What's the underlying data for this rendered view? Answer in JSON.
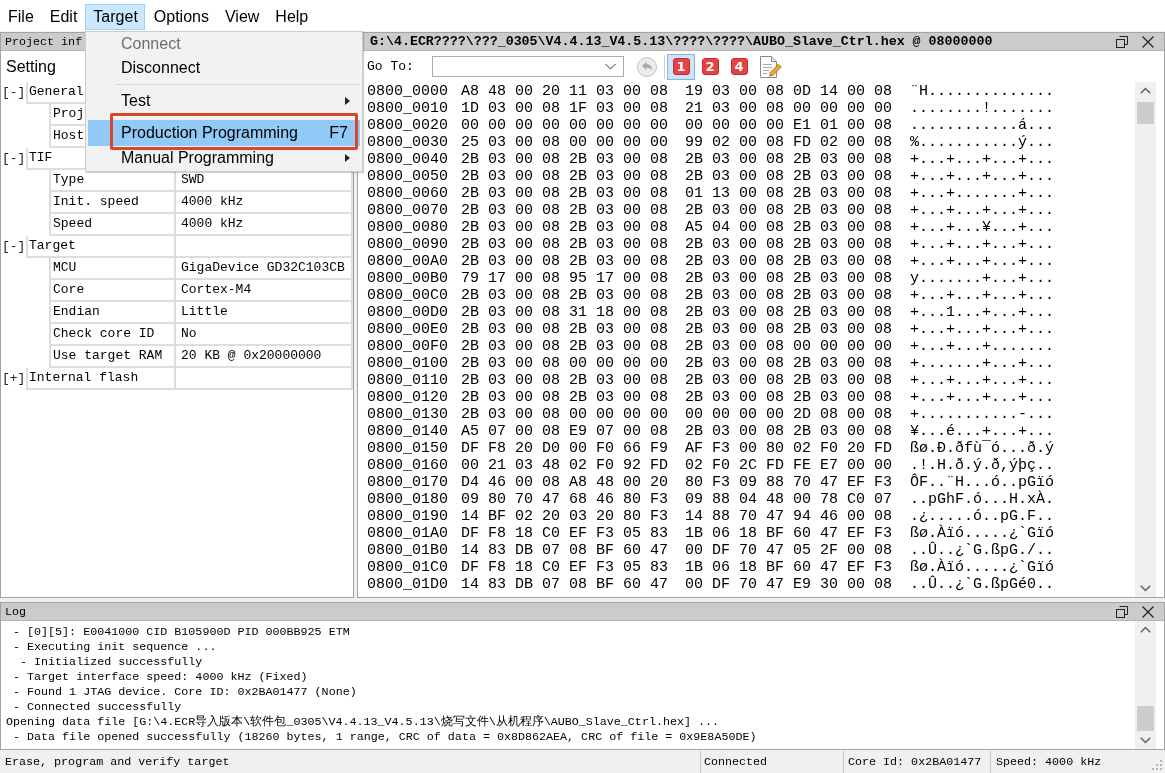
{
  "menu_bar": {
    "items": [
      {
        "label": "File",
        "selected": false
      },
      {
        "label": "Edit",
        "selected": false
      },
      {
        "label": "Target",
        "selected": true
      },
      {
        "label": "Options",
        "selected": false
      },
      {
        "label": "View",
        "selected": false
      },
      {
        "label": "Help",
        "selected": false
      }
    ]
  },
  "dropdown_menu": {
    "items": [
      {
        "kind": "item",
        "label": "Connect",
        "disabled": true,
        "selected": false,
        "marked": false
      },
      {
        "kind": "item",
        "label": "Disconnect",
        "disabled": false,
        "selected": false,
        "marked": false
      },
      {
        "kind": "separator"
      },
      {
        "kind": "submenu",
        "label": "Test",
        "disabled": false,
        "selected": false,
        "marked": false
      },
      {
        "kind": "item",
        "label": "Production Programming",
        "shortcut": "F7",
        "disabled": false,
        "selected": true,
        "marked": true
      },
      {
        "kind": "submenu",
        "label": "Manual Programming",
        "disabled": false,
        "selected": false,
        "marked": false
      }
    ]
  },
  "project_panel": {
    "title": "Project inf",
    "header": "Setting",
    "tree": [
      {
        "toggle": "[-]",
        "label": "General",
        "children": [
          {
            "label": "Proj"
          },
          {
            "label": "Host"
          }
        ]
      },
      {
        "toggle": "[-]",
        "label": "TIF",
        "children": [
          {
            "label": "Type",
            "value": "SWD"
          },
          {
            "label": "Init. speed",
            "value": "4000 kHz"
          },
          {
            "label": "Speed",
            "value": "4000 kHz"
          }
        ]
      },
      {
        "toggle": "[-]",
        "label": "Target",
        "children": [
          {
            "label": "MCU",
            "value": "GigaDevice GD32C103CB"
          },
          {
            "label": "Core",
            "value": "Cortex-M4"
          },
          {
            "label": "Endian",
            "value": "Little"
          },
          {
            "label": "Check core ID",
            "value": "No"
          },
          {
            "label": "Use target RAM",
            "value": "20 KB @ 0x20000000"
          }
        ]
      },
      {
        "toggle": "[+]",
        "label": "Internal flash"
      }
    ]
  },
  "hex_view": {
    "title": "G:\\4.ECR????\\???_0305\\V4.4.13_V4.5.13\\????\\????\\AUBO_Slave_Ctrl.hex @ 08000000",
    "goto_label": "Go To:",
    "toolbar": [
      {
        "kind": "back",
        "disabled": true
      },
      {
        "kind": "view",
        "label": "1",
        "selected": true
      },
      {
        "kind": "view",
        "label": "2",
        "selected": false
      },
      {
        "kind": "view",
        "label": "4",
        "selected": false
      },
      {
        "kind": "notes"
      }
    ],
    "rows": [
      {
        "address": "0800_0000",
        "bytes_1": "A8 48 00 20 11 03 00 08",
        "bytes_2": "19 03 00 08 0D 14 00 08",
        "ascii": "¨H.............."
      },
      {
        "address": "0800_0010",
        "bytes_1": "1D 03 00 08 1F 03 00 08",
        "bytes_2": "21 03 00 08 00 00 00 00",
        "ascii": "........!......."
      },
      {
        "address": "0800_0020",
        "bytes_1": "00 00 00 00 00 00 00 00",
        "bytes_2": "00 00 00 00 E1 01 00 08",
        "ascii": "............á..."
      },
      {
        "address": "0800_0030",
        "bytes_1": "25 03 00 08 00 00 00 00",
        "bytes_2": "99 02 00 08 FD 02 00 08",
        "ascii": "%...........ý..."
      },
      {
        "address": "0800_0040",
        "bytes_1": "2B 03 00 08 2B 03 00 08",
        "bytes_2": "2B 03 00 08 2B 03 00 08",
        "ascii": "+...+...+...+..."
      },
      {
        "address": "0800_0050",
        "bytes_1": "2B 03 00 08 2B 03 00 08",
        "bytes_2": "2B 03 00 08 2B 03 00 08",
        "ascii": "+...+...+...+..."
      },
      {
        "address": "0800_0060",
        "bytes_1": "2B 03 00 08 2B 03 00 08",
        "bytes_2": "01 13 00 08 2B 03 00 08",
        "ascii": "+...+.......+..."
      },
      {
        "address": "0800_0070",
        "bytes_1": "2B 03 00 08 2B 03 00 08",
        "bytes_2": "2B 03 00 08 2B 03 00 08",
        "ascii": "+...+...+...+..."
      },
      {
        "address": "0800_0080",
        "bytes_1": "2B 03 00 08 2B 03 00 08",
        "bytes_2": "A5 04 00 08 2B 03 00 08",
        "ascii": "+...+...¥...+..."
      },
      {
        "address": "0800_0090",
        "bytes_1": "2B 03 00 08 2B 03 00 08",
        "bytes_2": "2B 03 00 08 2B 03 00 08",
        "ascii": "+...+...+...+..."
      },
      {
        "address": "0800_00A0",
        "bytes_1": "2B 03 00 08 2B 03 00 08",
        "bytes_2": "2B 03 00 08 2B 03 00 08",
        "ascii": "+...+...+...+..."
      },
      {
        "address": "0800_00B0",
        "bytes_1": "79 17 00 08 95 17 00 08",
        "bytes_2": "2B 03 00 08 2B 03 00 08",
        "ascii": "y.......+...+..."
      },
      {
        "address": "0800_00C0",
        "bytes_1": "2B 03 00 08 2B 03 00 08",
        "bytes_2": "2B 03 00 08 2B 03 00 08",
        "ascii": "+...+...+...+..."
      },
      {
        "address": "0800_00D0",
        "bytes_1": "2B 03 00 08 31 18 00 08",
        "bytes_2": "2B 03 00 08 2B 03 00 08",
        "ascii": "+...1...+...+..."
      },
      {
        "address": "0800_00E0",
        "bytes_1": "2B 03 00 08 2B 03 00 08",
        "bytes_2": "2B 03 00 08 2B 03 00 08",
        "ascii": "+...+...+...+..."
      },
      {
        "address": "0800_00F0",
        "bytes_1": "2B 03 00 08 2B 03 00 08",
        "bytes_2": "2B 03 00 08 00 00 00 00",
        "ascii": "+...+...+......."
      },
      {
        "address": "0800_0100",
        "bytes_1": "2B 03 00 08 00 00 00 00",
        "bytes_2": "2B 03 00 08 2B 03 00 08",
        "ascii": "+.......+...+..."
      },
      {
        "address": "0800_0110",
        "bytes_1": "2B 03 00 08 2B 03 00 08",
        "bytes_2": "2B 03 00 08 2B 03 00 08",
        "ascii": "+...+...+...+..."
      },
      {
        "address": "0800_0120",
        "bytes_1": "2B 03 00 08 2B 03 00 08",
        "bytes_2": "2B 03 00 08 2B 03 00 08",
        "ascii": "+...+...+...+..."
      },
      {
        "address": "0800_0130",
        "bytes_1": "2B 03 00 08 00 00 00 00",
        "bytes_2": "00 00 00 00 2D 08 00 08",
        "ascii": "+...........-..."
      },
      {
        "address": "0800_0140",
        "bytes_1": "A5 07 00 08 E9 07 00 08",
        "bytes_2": "2B 03 00 08 2B 03 00 08",
        "ascii": "¥...é...+...+..."
      },
      {
        "address": "0800_0150",
        "bytes_1": "DF F8 20 D0 00 F0 66 F9",
        "bytes_2": "AF F3 00 80 02 F0 20 FD",
        "ascii": "ßø.Ð.ðfù¯ó...ð.ý"
      },
      {
        "address": "0800_0160",
        "bytes_1": "00 21 03 48 02 F0 92 FD",
        "bytes_2": "02 F0 2C FD FE E7 00 00",
        "ascii": ".!.H.ð.ý.ð,ýþç.."
      },
      {
        "address": "0800_0170",
        "bytes_1": "D4 46 00 08 A8 48 00 20",
        "bytes_2": "80 F3 09 88 70 47 EF F3",
        "ascii": "ÔF..¨H...ó..pGïó"
      },
      {
        "address": "0800_0180",
        "bytes_1": "09 80 70 47 68 46 80 F3",
        "bytes_2": "09 88 04 48 00 78 C0 07",
        "ascii": "..pGhF.ó...H.xÀ."
      },
      {
        "address": "0800_0190",
        "bytes_1": "14 BF 02 20 03 20 80 F3",
        "bytes_2": "14 88 70 47 94 46 00 08",
        "ascii": ".¿.....ó..pG.F.."
      },
      {
        "address": "0800_01A0",
        "bytes_1": "DF F8 18 C0 EF F3 05 83",
        "bytes_2": "1B 06 18 BF 60 47 EF F3",
        "ascii": "ßø.Àïó.....¿`Gïó"
      },
      {
        "address": "0800_01B0",
        "bytes_1": "14 83 DB 07 08 BF 60 47",
        "bytes_2": "00 DF 70 47 05 2F 00 08",
        "ascii": "..Û..¿`G.ßpG./.."
      },
      {
        "address": "0800_01C0",
        "bytes_1": "DF F8 18 C0 EF F3 05 83",
        "bytes_2": "1B 06 18 BF 60 47 EF F3",
        "ascii": "ßø.Àïó.....¿`Gïó"
      },
      {
        "address": "0800_01D0",
        "bytes_1": "14 83 DB 07 08 BF 60 47",
        "bytes_2": "00 DF 70 47 E9 30 00 08",
        "ascii": "..Û..¿`G.ßpGé0.."
      }
    ]
  },
  "log": {
    "title": "Log",
    "lines": [
      " - [0][5]: E0041000 CID B105900D PID 000BB925 ETM",
      " - Executing init sequence ...",
      "  - Initialized successfully",
      " - Target interface speed: 4000 kHz (Fixed)",
      " - Found 1 JTAG device. Core ID: 0x2BA01477 (None)",
      " - Connected successfully",
      "Opening data file [G:\\4.ECR导入版本\\软件包_0305\\V4.4.13_V4.5.13\\烧写文件\\从机程序\\AUBO_Slave_Ctrl.hex] ...",
      " - Data file opened successfully (18260 bytes, 1 range, CRC of data = 0x8D862AEA, CRC of file = 0x9E8A50DE)"
    ]
  },
  "status_bar": {
    "message": "Erase, program and verify target",
    "connection": "Connected",
    "core_id": "Core Id: 0x2BA01477",
    "speed": "Speed: 4000 kHz"
  }
}
